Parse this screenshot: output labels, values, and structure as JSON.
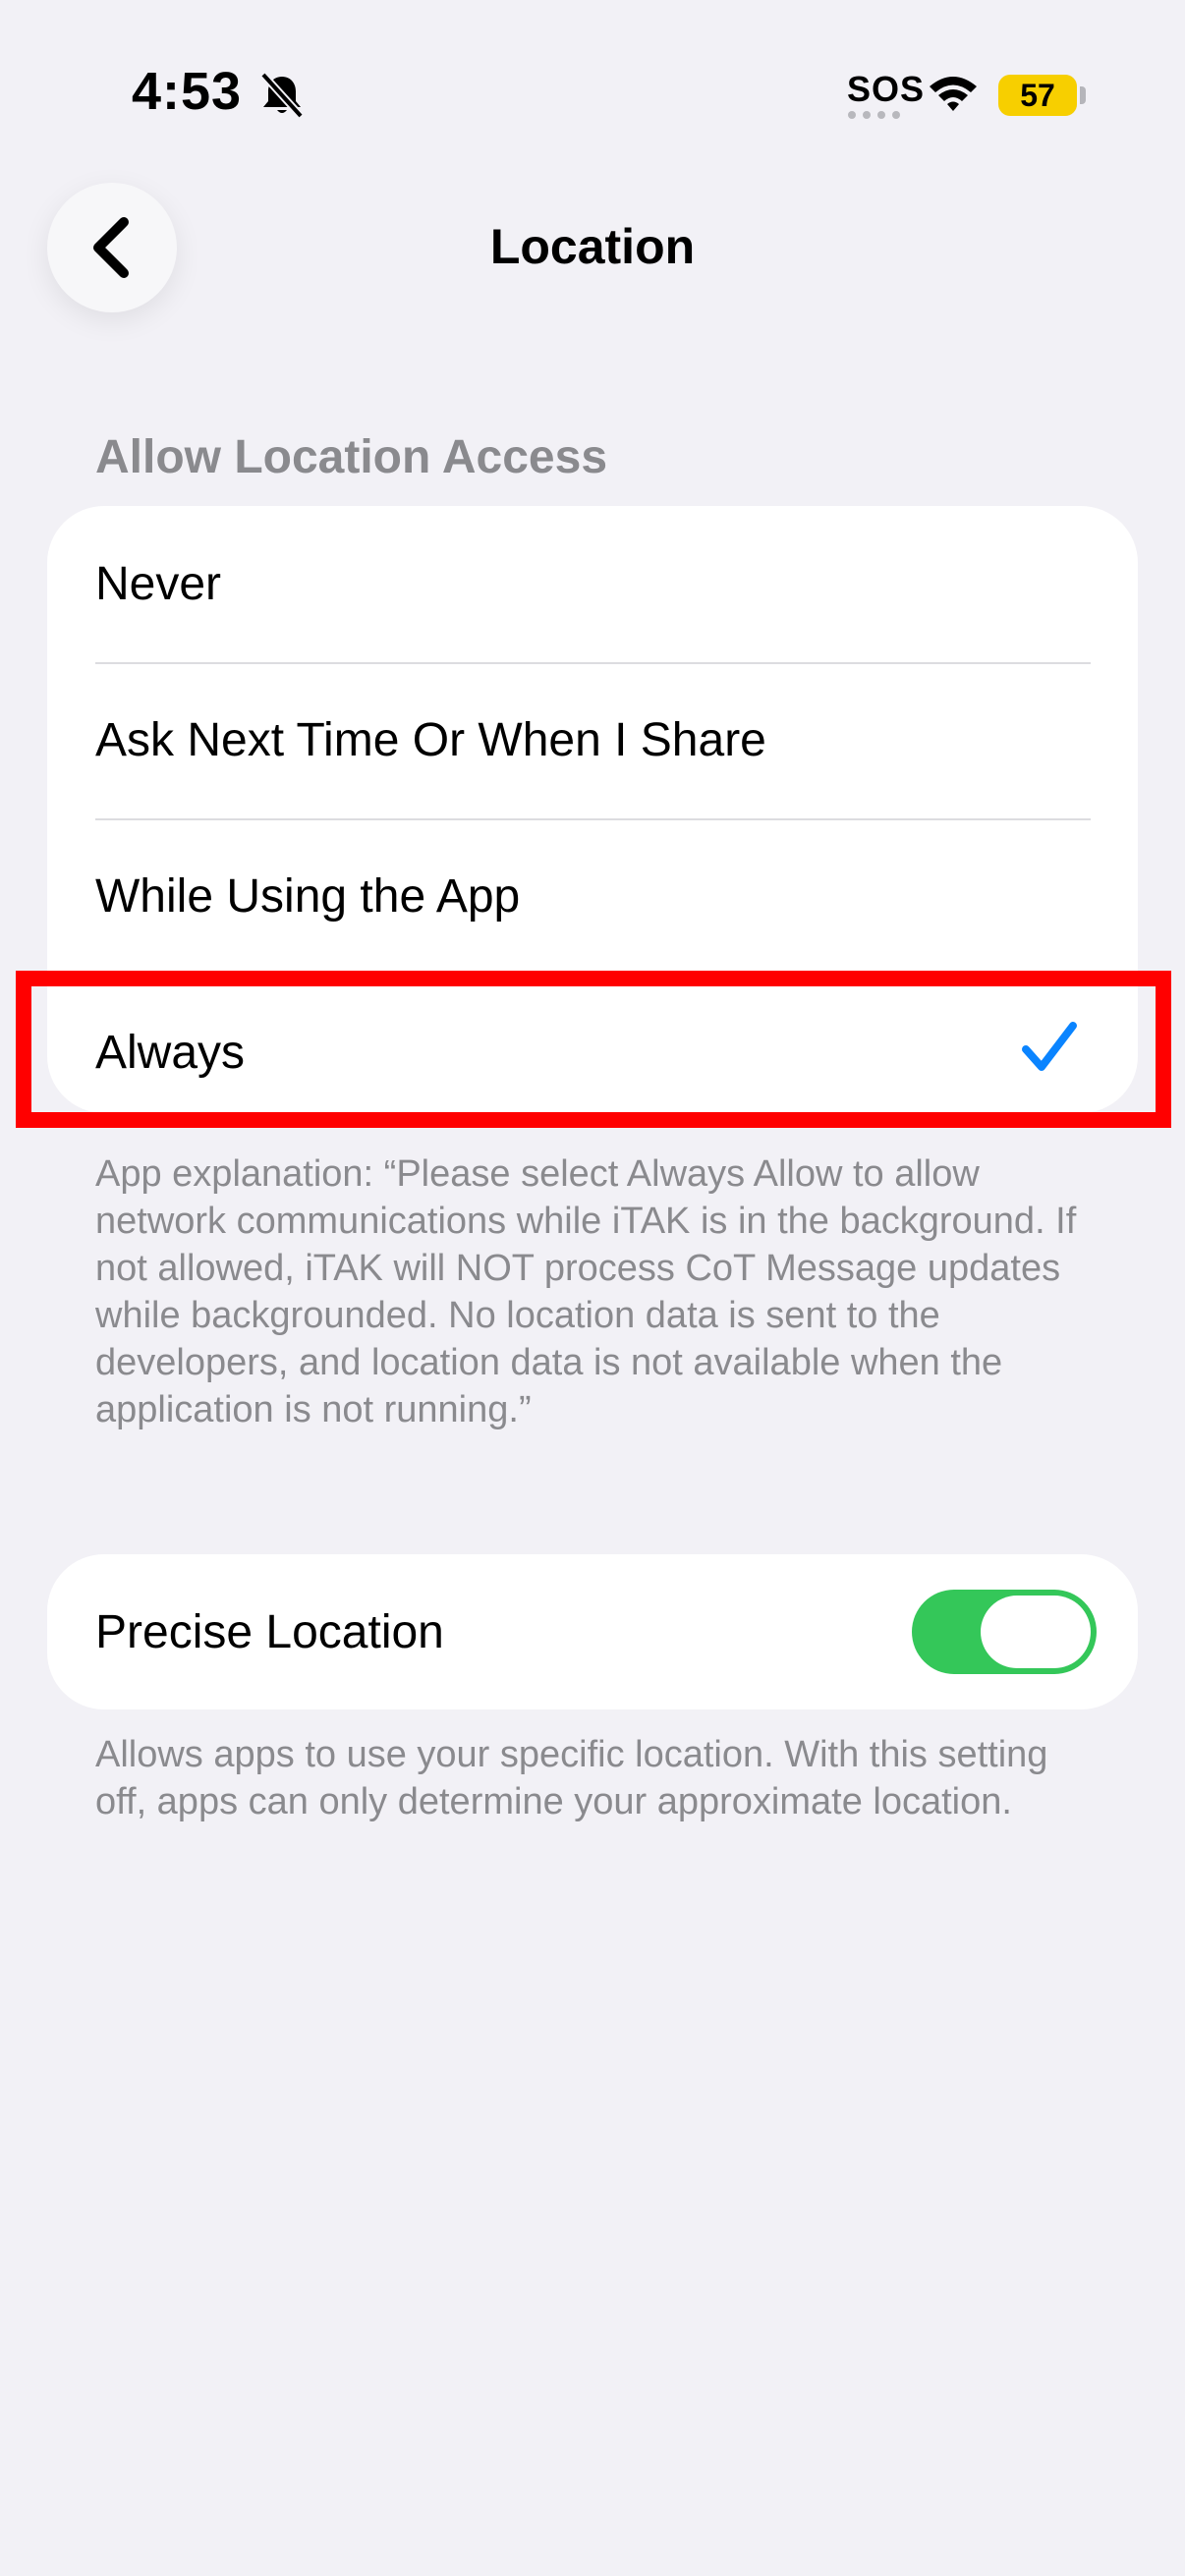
{
  "status_bar": {
    "time": "4:53",
    "sos": "SOS",
    "battery": "57",
    "icons": [
      "bell-slash-icon",
      "wifi-icon"
    ]
  },
  "nav": {
    "title": "Location",
    "back_icon": "chevron-left-icon"
  },
  "access": {
    "header": "Allow Location Access",
    "options": [
      {
        "label": "Never",
        "selected": false
      },
      {
        "label": "Ask Next Time Or When I Share",
        "selected": false
      },
      {
        "label": "While Using the App",
        "selected": false
      },
      {
        "label": "Always",
        "selected": true
      }
    ],
    "explanation": "App explanation: “Please select Always Allow to allow network communications while iTAK is in the background. If not allowed, iTAK will NOT process CoT Message updates while backgrounded. No location data is sent to the developers, and location data is not available when the application is not running.”"
  },
  "precise": {
    "label": "Precise Location",
    "enabled": true,
    "description": "Allows apps to use your specific location. With this setting off, apps can only determine your approximate location."
  },
  "colors": {
    "background": "#f2f1f6",
    "accent": "#0a84ff",
    "toggle_on": "#34c759",
    "highlight": "#ff0000",
    "secondary_text": "#8a8a8e"
  }
}
